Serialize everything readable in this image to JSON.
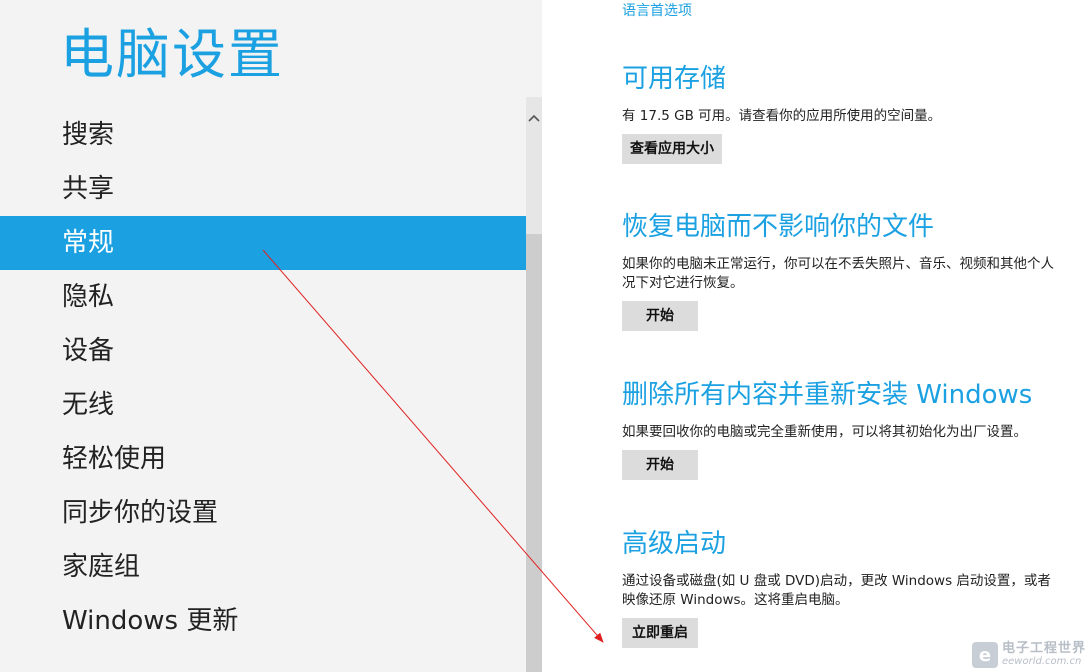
{
  "app_title": "电脑设置",
  "nav": {
    "items": [
      {
        "label": "搜索"
      },
      {
        "label": "共享"
      },
      {
        "label": "常规",
        "selected": true
      },
      {
        "label": "隐私"
      },
      {
        "label": "设备"
      },
      {
        "label": "无线"
      },
      {
        "label": "轻松使用"
      },
      {
        "label": "同步你的设置"
      },
      {
        "label": "家庭组"
      },
      {
        "label": "Windows 更新"
      }
    ]
  },
  "content": {
    "language_link": "语言首选项",
    "storage": {
      "title": "可用存储",
      "desc": "有 17.5 GB 可用。请查看你的应用所使用的空间量。",
      "button": "查看应用大小"
    },
    "refresh": {
      "title": "恢复电脑而不影响你的文件",
      "desc_line1": "如果你的电脑未正常运行，你可以在不丢失照片、音乐、视频和其他个人",
      "desc_line2": "况下对它进行恢复。",
      "button": "开始"
    },
    "reset": {
      "title": "删除所有内容并重新安装 Windows",
      "desc": "如果要回收你的电脑或完全重新使用，可以将其初始化为出厂设置。",
      "button": "开始"
    },
    "advanced": {
      "title": "高级启动",
      "desc_line1": "通过设备或磁盘(如 U 盘或 DVD)启动，更改 Windows 启动设置，或者",
      "desc_line2": "映像还原 Windows。这将重启电脑。",
      "button": "立即重启"
    }
  },
  "watermark": {
    "logo": "e",
    "cn": "电子工程世界",
    "en": "eeworld.com.cn"
  },
  "colors": {
    "accent": "#1ba1e2",
    "annotation_arrow": "#e02020"
  }
}
